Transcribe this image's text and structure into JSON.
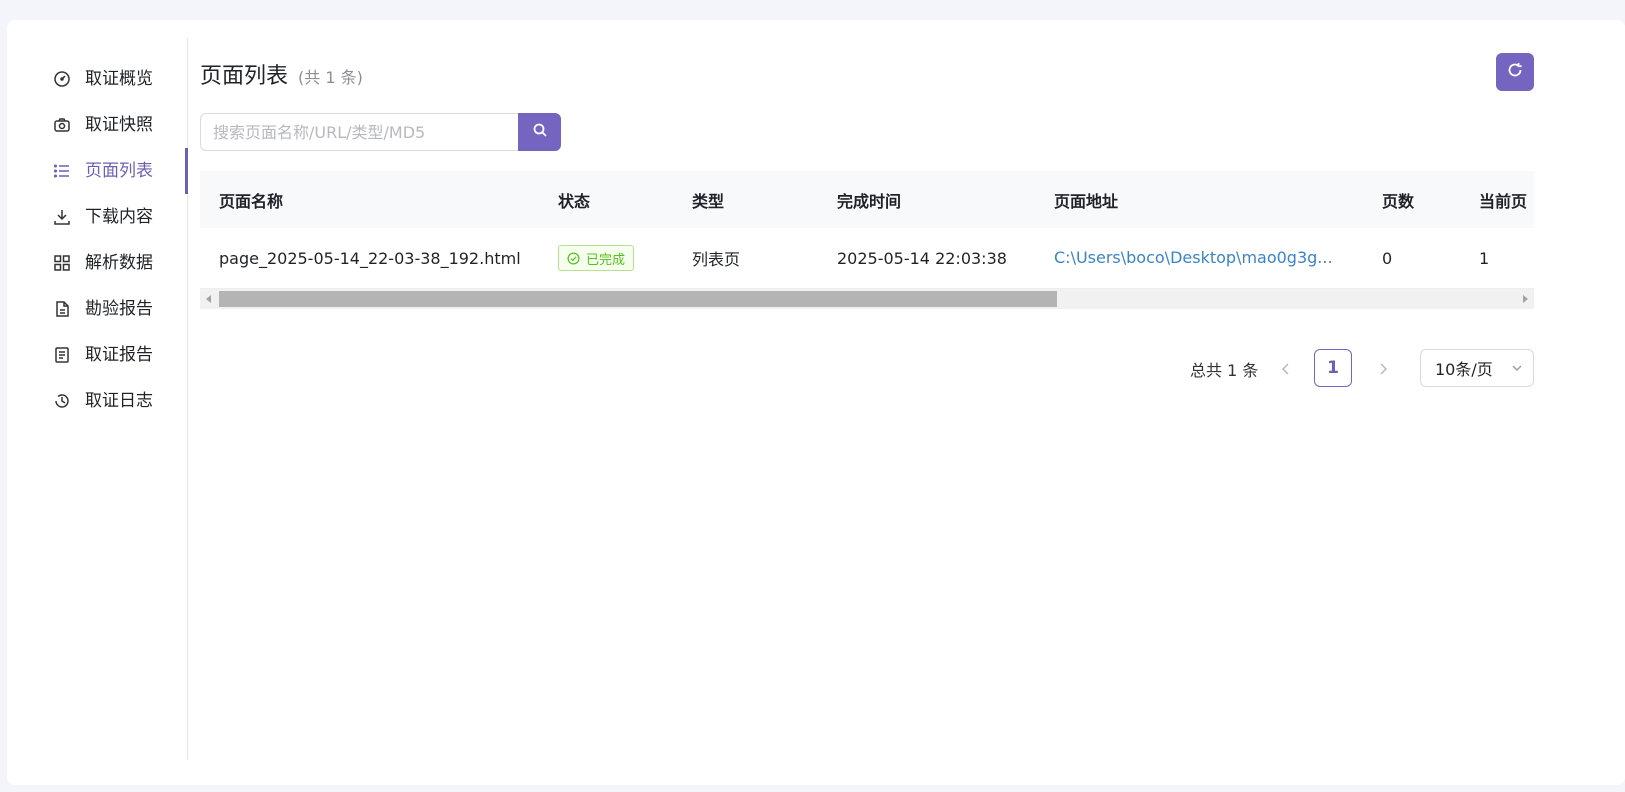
{
  "sidebar": {
    "items": [
      {
        "label": "取证概览",
        "icon": "dashboard-icon"
      },
      {
        "label": "取证快照",
        "icon": "camera-icon"
      },
      {
        "label": "页面列表",
        "icon": "list-icon",
        "active": true
      },
      {
        "label": "下载内容",
        "icon": "download-icon"
      },
      {
        "label": "解析数据",
        "icon": "grid-icon"
      },
      {
        "label": "勘验报告",
        "icon": "document-icon"
      },
      {
        "label": "取证报告",
        "icon": "report-icon"
      },
      {
        "label": "取证日志",
        "icon": "history-icon"
      }
    ]
  },
  "main": {
    "title": "页面列表",
    "count": "(共 1 条)",
    "search": {
      "placeholder": "搜索页面名称/URL/类型/MD5",
      "value": ""
    }
  },
  "table": {
    "columns": [
      "页面名称",
      "状态",
      "类型",
      "完成时间",
      "页面地址",
      "页数",
      "当前页"
    ],
    "rows": [
      {
        "name": "page_2025-05-14_22-03-38_192.html",
        "status": "已完成",
        "type": "列表页",
        "finish_time": "2025-05-14 22:03:38",
        "address": "C:\\Users\\boco\\Desktop\\mao0g3g...",
        "pages": "0",
        "current_page": "1"
      }
    ]
  },
  "pagination": {
    "total": "总共 1 条",
    "current": "1",
    "page_size": "10条/页"
  },
  "colors": {
    "accent": "#7565c1",
    "link": "#3a84c9",
    "success": "#52c41a"
  }
}
